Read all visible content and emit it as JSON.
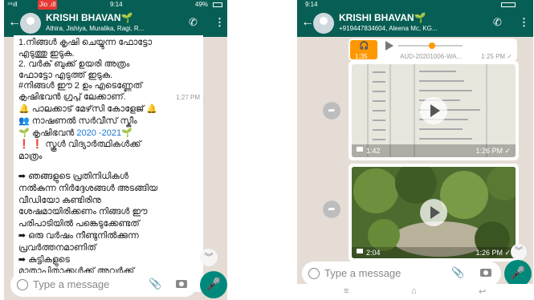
{
  "left": {
    "status": {
      "signal": "⁴⁶ıll",
      "indicators": "Jio .ıll",
      "time": "9:14",
      "battery": "49%"
    },
    "header": {
      "title": "KRISHI BHAVAN",
      "subtitle": "Athira, Jishiya, Muralika, Ragi, R..."
    },
    "msg1": {
      "lines": [
        "1.നിങ്ങൾ കൃഷി ചെയ്യുന്ന ഫോട്ടോ",
        "എടുത്തു ഇടുക.",
        "2. വർക് ബുക്ക് ഉയരി അത്രം",
        "ഫോട്ടോ എടുത്ത് ഇടുക.",
        "#നിങ്ങൾ ഈ 2 ഉം എടെണ്ണേത്"
      ],
      "last": "കൃഷിഭവൻ ഗ്രൂപ്പ് ലേക്കാണ്.",
      "time": "1:27 PM"
    },
    "msg2": {
      "l1": "🔔 പാലക്കാട് മേഴ്‌സി കോളേജ് 🔔",
      "l2": "👥 നാഷണൽ സർവീസ് സ്കീം",
      "l3a": "🌱 കൃഷിഭവൻ ",
      "l3b": "2020 -2021",
      "l3c": "🌱",
      "l4": "❗ ❗ സ്കൂൾ വിദ്യാർത്ഥികൾക്ക്",
      "l5": "മാത്രം",
      "p1": [
        "➡ ഞങ്ങളുടെ പ്രതിനിധികൾ",
        "നൽകുന്ന നിർദ്ദേശങ്ങൾ അടങ്ങിയ",
        "വീഡിയോ കണ്ടിരിനു",
        "ശേഷമായിരിക്കണം നിങ്ങൾ ഈ",
        "പരിപാടിയിൽ പങ്കെടുക്കേണ്ടത്"
      ],
      "p2": [
        "➡ ഒരു വർഷം നീണ്ടുനിൽക്കുന്ന",
        "പ്രവർത്തനമാണിത്"
      ],
      "p3": [
        "➡ കുട്ടികളുടെ",
        "മാതാപിതാക്കൾക്ക് അവർക്ക്"
      ]
    },
    "input": {
      "placeholder": "Type a message"
    }
  },
  "right": {
    "status": {
      "time": "9:14"
    },
    "header": {
      "title": "KRISHI BHAVAN",
      "subtitle": "+919447834604, Aleena Mc, KG..."
    },
    "audio": {
      "duration": "1:35",
      "filename": "AUD-20201006-WA...",
      "time": "1:25 PM ✓"
    },
    "video1": {
      "duration": "1:42",
      "time": "1:26 PM ✓"
    },
    "video2": {
      "duration": "2:04",
      "time": "1:26 PM ✓"
    },
    "input": {
      "placeholder": "Type a message"
    }
  },
  "colors": {
    "header": "#075e54",
    "accent": "#00897b",
    "chat_bg": "#e5ddd5",
    "year_text": "#1976d2",
    "audio_orange": "#ff9800"
  }
}
